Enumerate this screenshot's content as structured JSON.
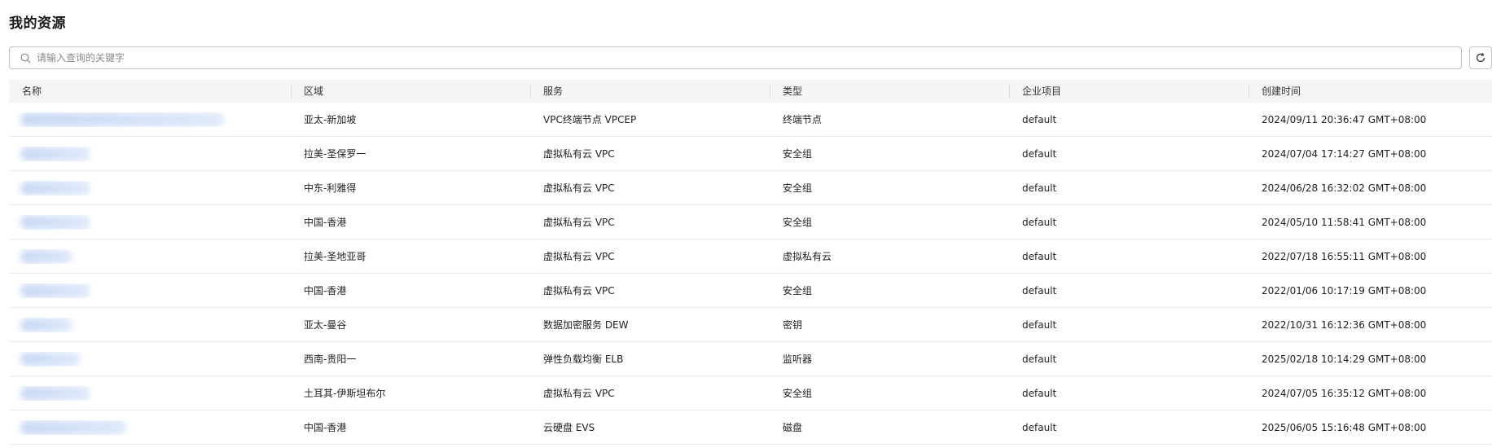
{
  "page": {
    "title": "我的资源"
  },
  "search": {
    "placeholder": "请输入查询的关键字",
    "value": ""
  },
  "icons": {
    "search": "search-icon",
    "refresh": "refresh-icon"
  },
  "table": {
    "columns": [
      "名称",
      "区域",
      "服务",
      "类型",
      "企业项目",
      "创建时间"
    ],
    "rows": [
      {
        "region": "亚太-新加坡",
        "service": "VPC终端节点 VPCEP",
        "type": "终端节点",
        "project": "default",
        "created": "2024/09/11 20:36:47 GMT+08:00"
      },
      {
        "region": "拉美-圣保罗一",
        "service": "虚拟私有云 VPC",
        "type": "安全组",
        "project": "default",
        "created": "2024/07/04 17:14:27 GMT+08:00"
      },
      {
        "region": "中东-利雅得",
        "service": "虚拟私有云 VPC",
        "type": "安全组",
        "project": "default",
        "created": "2024/06/28 16:32:02 GMT+08:00"
      },
      {
        "region": "中国-香港",
        "service": "虚拟私有云 VPC",
        "type": "安全组",
        "project": "default",
        "created": "2024/05/10 11:58:41 GMT+08:00"
      },
      {
        "region": "拉美-圣地亚哥",
        "service": "虚拟私有云 VPC",
        "type": "虚拟私有云",
        "project": "default",
        "created": "2022/07/18 16:55:11 GMT+08:00"
      },
      {
        "region": "中国-香港",
        "service": "虚拟私有云 VPC",
        "type": "安全组",
        "project": "default",
        "created": "2022/01/06 10:17:19 GMT+08:00"
      },
      {
        "region": "亚太-曼谷",
        "service": "数据加密服务 DEW",
        "type": "密钥",
        "project": "default",
        "created": "2022/10/31 16:12:36 GMT+08:00"
      },
      {
        "region": "西南-贵阳一",
        "service": "弹性负载均衡 ELB",
        "type": "监听器",
        "project": "default",
        "created": "2025/02/18 10:14:29 GMT+08:00"
      },
      {
        "region": "土耳其-伊斯坦布尔",
        "service": "虚拟私有云 VPC",
        "type": "安全组",
        "project": "default",
        "created": "2024/07/05 16:35:12 GMT+08:00"
      },
      {
        "region": "中国-香港",
        "service": "云硬盘 EVS",
        "type": "磁盘",
        "project": "default",
        "created": "2025/06/05 15:16:48 GMT+08:00"
      }
    ]
  },
  "colors": {
    "name_link_blur": "#c8daf5",
    "header_bg": "#f5f5f5",
    "border": "#c2c2c2"
  }
}
